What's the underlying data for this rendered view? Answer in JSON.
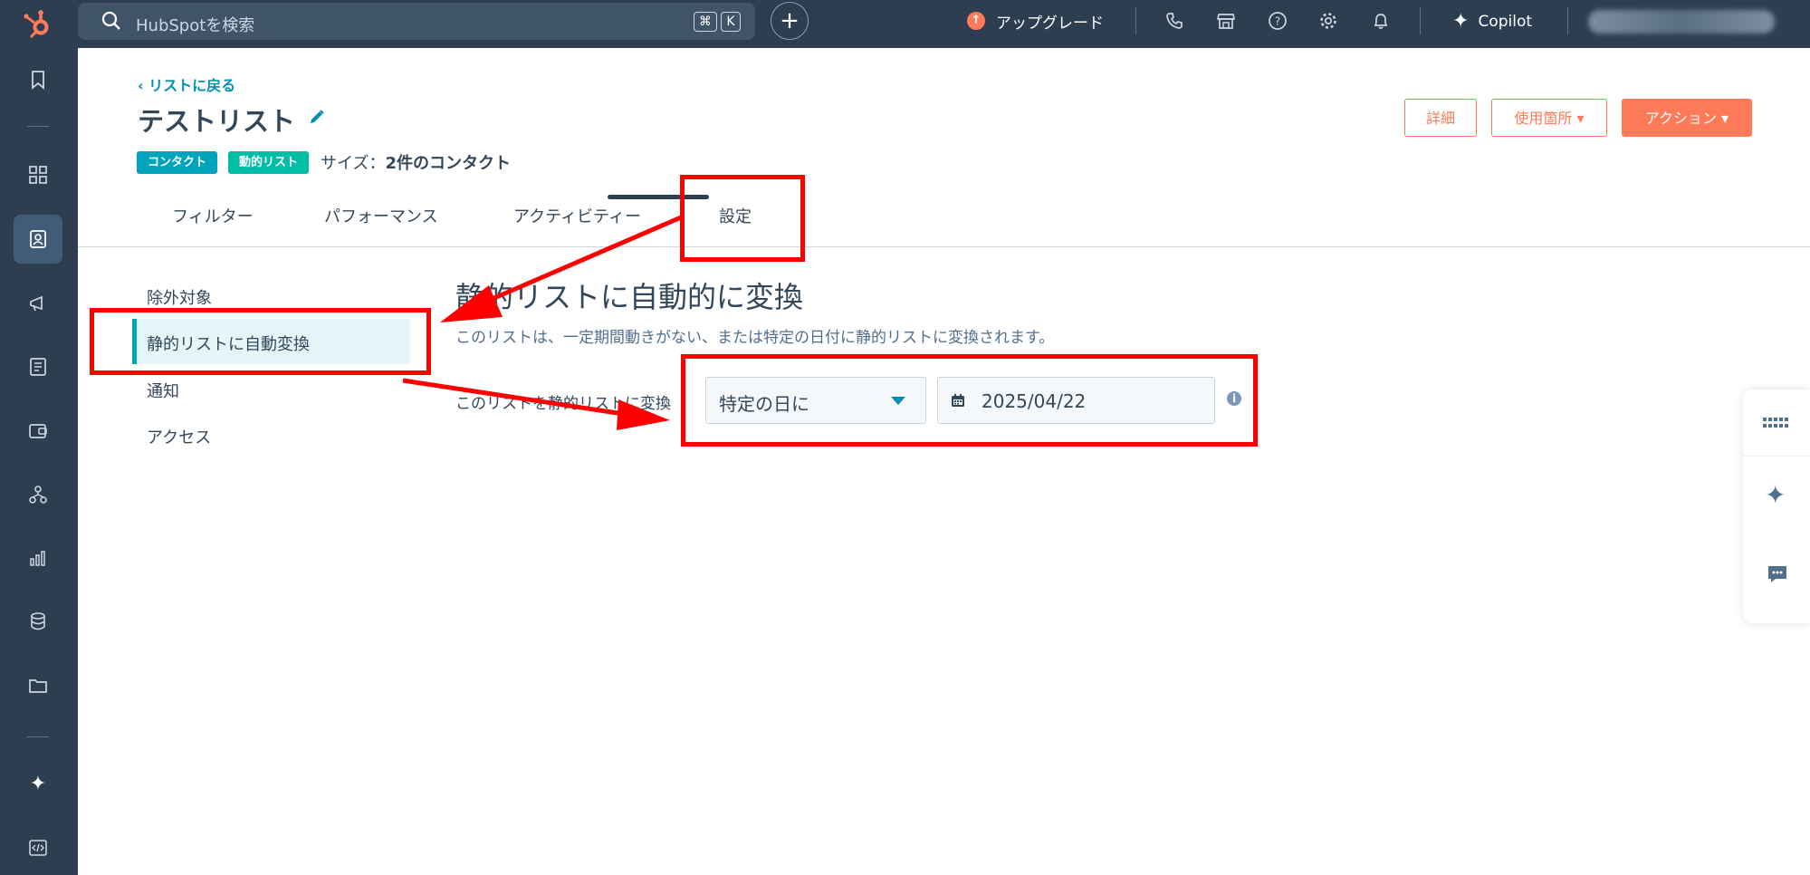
{
  "topbar": {
    "search_placeholder": "HubSpotを検索",
    "shortcut_key1": "⌘",
    "shortcut_key2": "K",
    "upgrade_label": "アップグレード",
    "copilot_label": "Copilot"
  },
  "header": {
    "back_link": "リストに戻る",
    "title": "テストリスト",
    "tag_contact": "コンタクト",
    "tag_dynamic": "動的リスト",
    "size_label": "サイズ：",
    "size_value": "2件のコンタクト",
    "details_button": "詳細",
    "usage_button": "使用箇所",
    "actions_button": "アクション"
  },
  "tabs": [
    {
      "label": "フィルター"
    },
    {
      "label": "パフォーマンス"
    },
    {
      "label": "アクティビティー"
    },
    {
      "label": "設定"
    }
  ],
  "settings_menu": [
    {
      "label": "除外対象"
    },
    {
      "label": "静的リストに自動変換"
    },
    {
      "label": "通知"
    },
    {
      "label": "アクセス"
    }
  ],
  "section": {
    "title": "静的リストに自動的に変換",
    "description": "このリストは、一定期間動きがない、または特定の日付に静的リストに変換されます。",
    "row_label": "このリストを静的リストに変換",
    "select_value": "特定の日に",
    "date_value": "2025/04/22"
  },
  "colors": {
    "accent": "#ff7a59",
    "nav_bg": "#2d3e50",
    "teal": "#00a4bd",
    "annotation": "#ff0000"
  }
}
